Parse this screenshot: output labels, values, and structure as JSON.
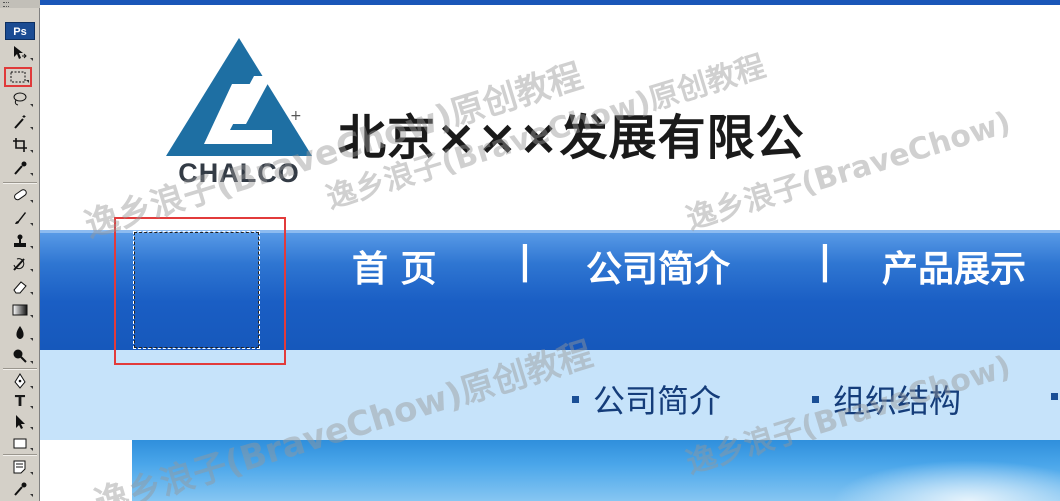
{
  "app": {
    "name": "Photoshop",
    "logo_label": "Ps"
  },
  "toolbar": {
    "tools": [
      {
        "name": "move-tool",
        "icon": "move-icon"
      },
      {
        "name": "rectangular-marquee-tool",
        "icon": "marquee-icon",
        "active": true
      },
      {
        "name": "lasso-tool",
        "icon": "lasso-icon"
      },
      {
        "name": "magic-wand-tool",
        "icon": "magic-wand-icon"
      },
      {
        "name": "crop-tool",
        "icon": "crop-icon"
      },
      {
        "name": "eyedropper-tool",
        "icon": "eyedropper-icon"
      },
      {
        "name": "healing-brush-tool",
        "icon": "bandage-icon"
      },
      {
        "name": "brush-tool",
        "icon": "brush-icon"
      },
      {
        "name": "clone-stamp-tool",
        "icon": "stamp-icon"
      },
      {
        "name": "history-brush-tool",
        "icon": "history-brush-icon"
      },
      {
        "name": "eraser-tool",
        "icon": "eraser-icon"
      },
      {
        "name": "gradient-tool",
        "icon": "gradient-icon"
      },
      {
        "name": "blur-tool",
        "icon": "drop-icon"
      },
      {
        "name": "dodge-tool",
        "icon": "dodge-icon"
      },
      {
        "name": "pen-tool",
        "icon": "pen-icon"
      },
      {
        "name": "type-tool",
        "icon": "type-icon",
        "label": "T"
      },
      {
        "name": "path-selection-tool",
        "icon": "arrow-icon"
      },
      {
        "name": "shape-tool",
        "icon": "rectangle-icon"
      },
      {
        "name": "notes-tool",
        "icon": "note-icon"
      },
      {
        "name": "eyedropper-tool-2",
        "icon": "eyedropper-icon"
      }
    ]
  },
  "site": {
    "logo_text": "CHALCO",
    "company_title": "北京×××发展有限公",
    "nav": [
      "首 页",
      "公司简介",
      "产品展示"
    ],
    "nav_separator": "|",
    "subnav": [
      "公司简介",
      "组织结构"
    ]
  },
  "watermark": {
    "text1": "逸乡浪子(BraveChow)原创教程",
    "text2": "逸乡浪子(BraveChow)原创教程",
    "text3": "逸乡浪子(BraveChow)原创教程",
    "text4": "逸乡浪子(BraveChow)",
    "text5": "逸乡浪子(BraveChow)"
  },
  "colors": {
    "highlight": "#e23b3b",
    "logo_blue": "#1e6fa3",
    "nav_blue": "#1a5ec4",
    "subnav_bg": "#c6e3fa",
    "ps_blue": "#1b4c93"
  }
}
